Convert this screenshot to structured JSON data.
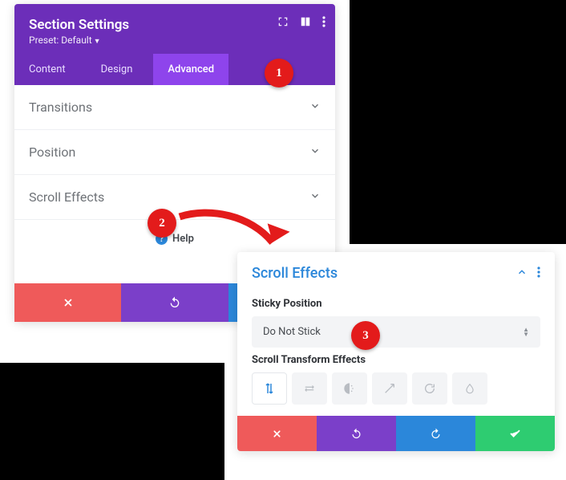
{
  "annotations": {
    "b1": "1",
    "b2": "2",
    "b3": "3"
  },
  "panel1": {
    "title": "Section Settings",
    "preset_label": "Preset: Default",
    "tabs": {
      "content": "Content",
      "design": "Design",
      "advanced": "Advanced",
      "active": "advanced"
    },
    "sections": {
      "transitions": "Transitions",
      "position": "Position",
      "scroll_effects": "Scroll Effects"
    },
    "help": "Help"
  },
  "panel2": {
    "title": "Scroll Effects",
    "sticky_label": "Sticky Position",
    "sticky_value": "Do Not Stick",
    "transform_label": "Scroll Transform Effects",
    "icons": [
      "vertical-motion",
      "horizontal-motion",
      "fade",
      "scale",
      "rotate",
      "blur"
    ]
  }
}
